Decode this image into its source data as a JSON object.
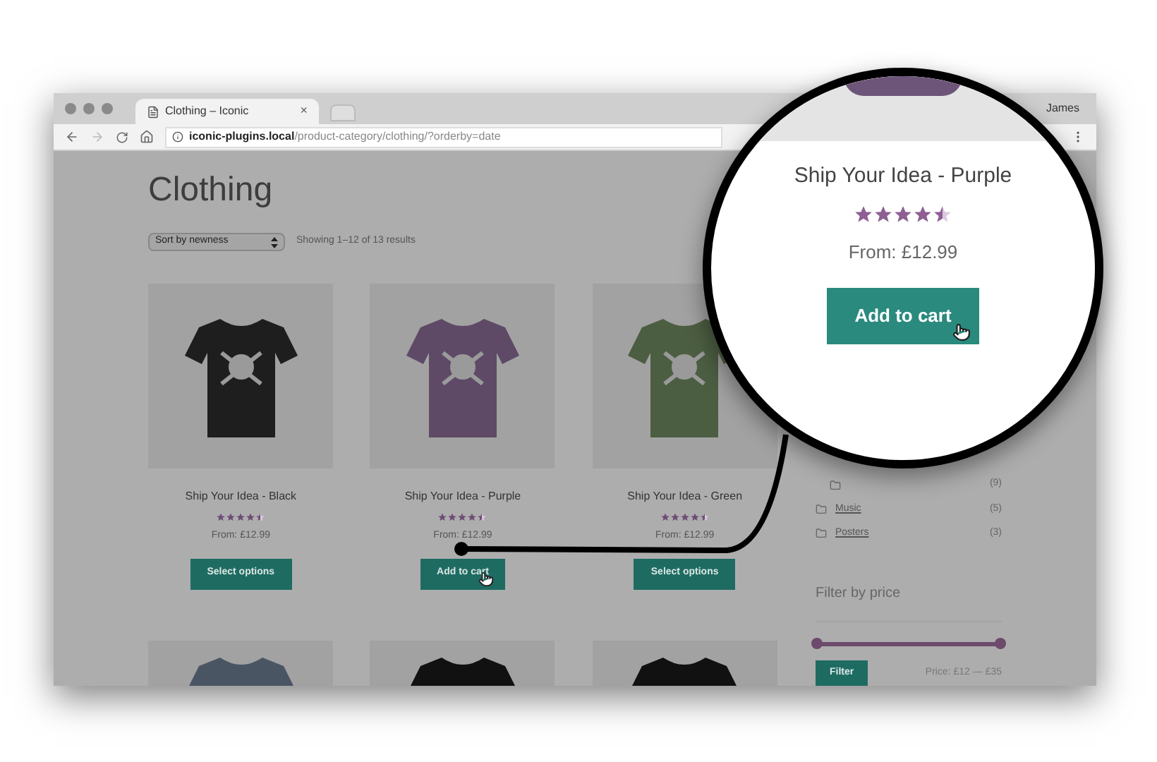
{
  "browser": {
    "tab_title": "Clothing – Iconic",
    "tab_close": "×",
    "user": "James",
    "url_host": "iconic-plugins.local",
    "url_path": "/product-category/clothing/?orderby=date"
  },
  "page": {
    "title": "Clothing",
    "sort": "Sort by newness",
    "result_count": "Showing 1–12 of 13 results"
  },
  "products": [
    {
      "name": "Ship Your Idea - Black",
      "stars": 4.5,
      "price": "From: £12.99",
      "button": "Select options",
      "color": "#1e1e1e",
      "pointer": false
    },
    {
      "name": "Ship Your Idea - Purple",
      "stars": 4.5,
      "price": "From: £12.99",
      "button": "Add to cart",
      "color": "#5e4a66",
      "pointer": true
    },
    {
      "name": "Ship Your Idea - Green",
      "stars": 4.5,
      "price": "From: £12.99",
      "button": "Select options",
      "color": "#4c5e42",
      "pointer": false
    }
  ],
  "more_products": [
    {
      "color": "#4a5564"
    },
    {
      "color": "#111111"
    },
    {
      "color": "#111111"
    }
  ],
  "sidebar": {
    "categories": [
      {
        "count": "(9)"
      },
      {
        "label": "Music",
        "count": "(5)"
      },
      {
        "label": "Posters",
        "count": "(3)"
      }
    ],
    "filter_title": "Filter by price",
    "slider": {
      "level": 1
    },
    "filter_button": "Filter",
    "price_range": "Price: £12 — £35"
  },
  "magnifier": {
    "name": "Ship Your Idea - Purple",
    "stars": 4.5,
    "price": "From: £12.99",
    "button": "Add to cart",
    "color": "#6d5579"
  }
}
